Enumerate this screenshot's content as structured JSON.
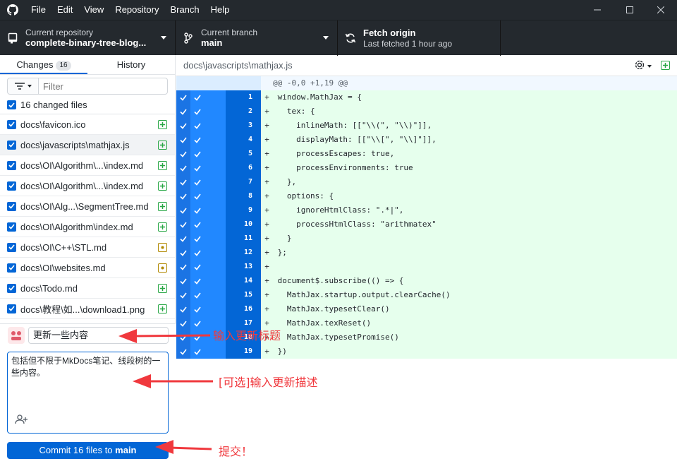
{
  "menu": [
    "File",
    "Edit",
    "View",
    "Repository",
    "Branch",
    "Help"
  ],
  "toolbar": {
    "repo_label": "Current repository",
    "repo_value": "complete-binary-tree-blog...",
    "branch_label": "Current branch",
    "branch_value": "main",
    "fetch_label": "Fetch origin",
    "fetch_sub": "Last fetched 1 hour ago"
  },
  "tabs": {
    "changes": "Changes",
    "changes_count": "16",
    "history": "History"
  },
  "filter": {
    "placeholder": "Filter"
  },
  "files": {
    "all_label": "16 changed files",
    "items": [
      {
        "name": "docs\\favicon.ico",
        "status": "added"
      },
      {
        "name": "docs\\javascripts\\mathjax.js",
        "status": "added"
      },
      {
        "name": "docs\\OI\\Algorithm\\...\\index.md",
        "status": "added"
      },
      {
        "name": "docs\\OI\\Algorithm\\...\\index.md",
        "status": "added"
      },
      {
        "name": "docs\\OI\\Alg...\\SegmentTree.md",
        "status": "added"
      },
      {
        "name": "docs\\OI\\Algorithm\\index.md",
        "status": "added"
      },
      {
        "name": "docs\\OI\\C++\\STL.md",
        "status": "modified"
      },
      {
        "name": "docs\\OI\\websites.md",
        "status": "modified"
      },
      {
        "name": "docs\\Todo.md",
        "status": "added"
      },
      {
        "name": "docs\\教程\\如...\\download1.png",
        "status": "added"
      }
    ]
  },
  "commit": {
    "summary": "更新一些内容",
    "description": "包括但不限于MkDocs笔记、线段树的一些内容。",
    "button_prefix": "Commit 16 files to ",
    "button_branch": "main"
  },
  "diff": {
    "path": "docs\\javascripts\\mathjax.js",
    "hunk": "@@ -0,0 +1,19 @@",
    "lines": [
      "window.MathJax = {",
      "  tex: {",
      "    inlineMath: [[\"\\\\(\", \"\\\\)\"]],",
      "    displayMath: [[\"\\\\[\", \"\\\\]\"]],",
      "    processEscapes: true,",
      "    processEnvironments: true",
      "  },",
      "  options: {",
      "    ignoreHtmlClass: \".*|\",",
      "    processHtmlClass: \"arithmatex\"",
      "  }",
      "};",
      "",
      "document$.subscribe(() => {",
      "  MathJax.startup.output.clearCache()",
      "  MathJax.typesetClear()",
      "  MathJax.texReset()",
      "  MathJax.typesetPromise()",
      "})"
    ]
  },
  "annotations": {
    "title": "输入更新标题",
    "desc": "[可选]输入更新描述",
    "submit": "提交！"
  },
  "colors": {
    "accent": "#0366d6",
    "added": "#28a745",
    "modified": "#b08800",
    "annot": "#f0383d"
  }
}
